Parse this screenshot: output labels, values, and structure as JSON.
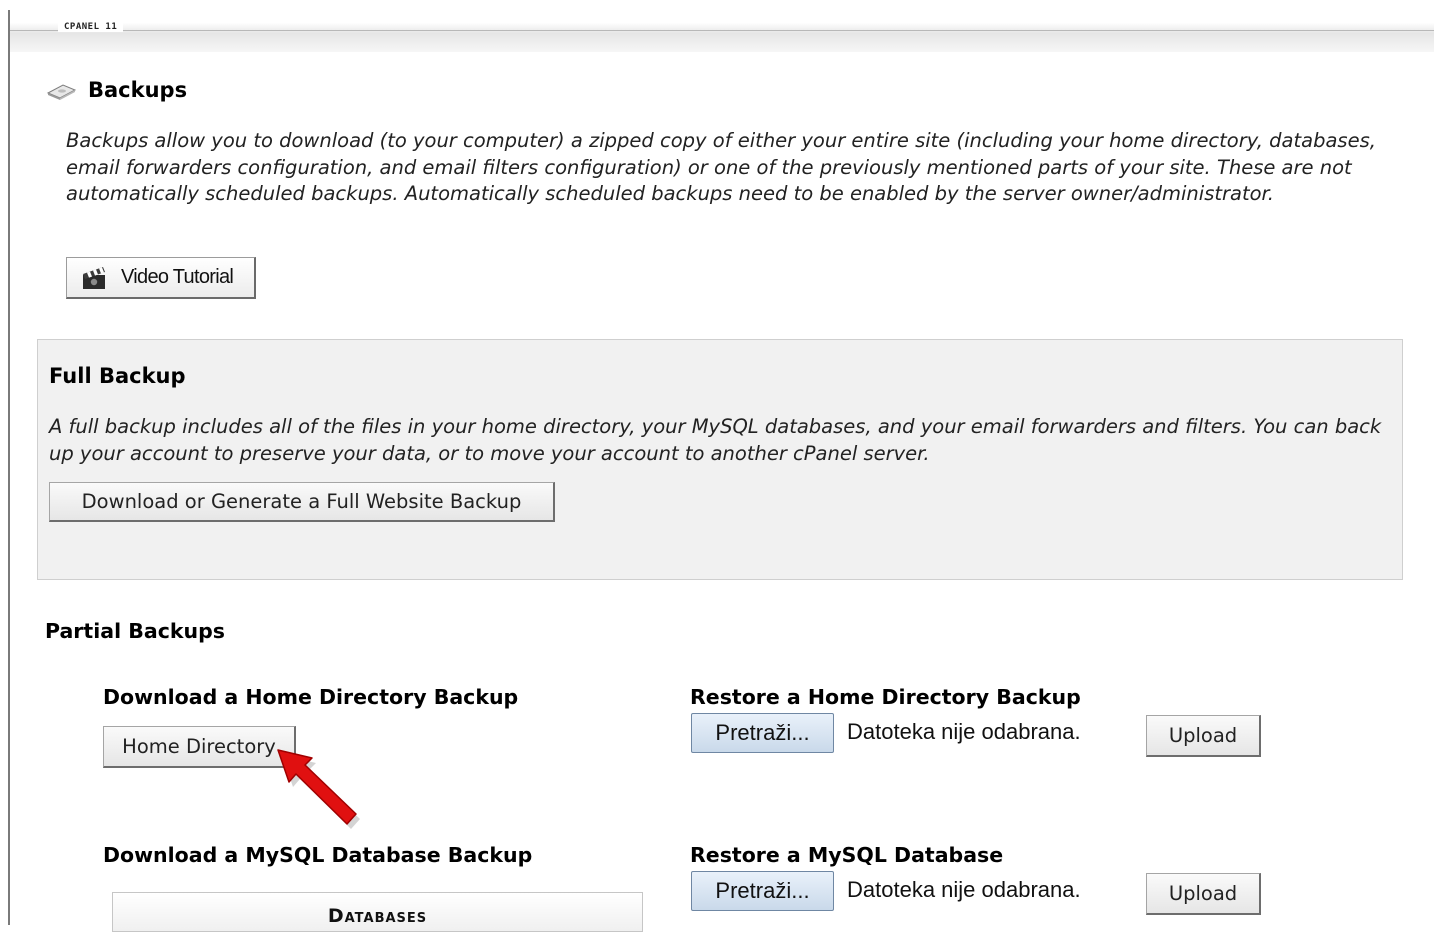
{
  "brand": "CPANEL 11",
  "page": {
    "title": "Backups",
    "intro": "Backups allow you to download (to your computer) a zipped copy of either your entire site (including your home directory, databases, email forwarders configuration, and email filters configuration) or one of the previously mentioned parts of your site. These are not automatically scheduled backups. Automatically scheduled backups need to be enabled by the server owner/administrator.",
    "video_tutorial_label": "Video Tutorial",
    "icons": {
      "title_icon": "backup-drive-icon",
      "video_icon": "clapperboard-icon",
      "pointer": "red-arrow-annotation"
    }
  },
  "full_backup": {
    "heading": "Full Backup",
    "description": "A full backup includes all of the files in your home directory, your MySQL databases, and your email forwarders and filters. You can back up your account to preserve your data, or to move your account to another cPanel server.",
    "button_label": "Download or Generate a Full Website Backup"
  },
  "partial": {
    "heading": "Partial Backups",
    "home_download_heading": "Download a Home Directory Backup",
    "home_button_label": "Home Directory",
    "home_restore_heading": "Restore a Home Directory Backup",
    "mysql_download_heading": "Download a MySQL Database Backup",
    "mysql_restore_heading": "Restore a MySQL Database",
    "databases_header": "Databases",
    "browse_label": "Pretraži...",
    "no_file_text": "Datoteka nije odabrana.",
    "upload_label": "Upload"
  },
  "colors": {
    "panel_bg": "#f1f1f1",
    "annotation_arrow": "#e01010",
    "file_button": "#d6e3f1"
  }
}
